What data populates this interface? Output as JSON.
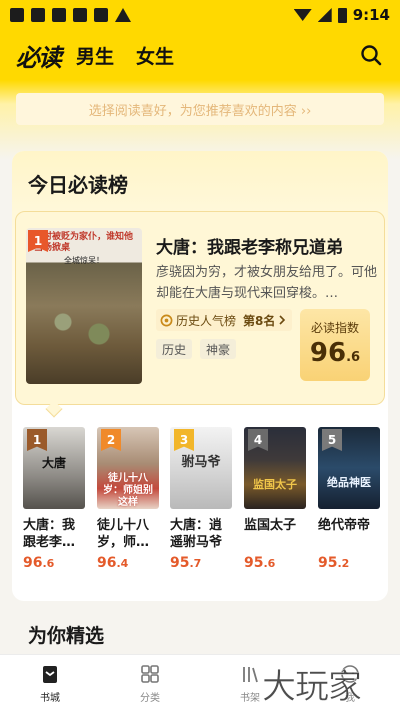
{
  "status_bar": {
    "time": "9:14"
  },
  "header": {
    "logo": "必读",
    "tabs": [
      {
        "label": "男生"
      },
      {
        "label": "女生"
      }
    ]
  },
  "preference_bar": {
    "text": "选择阅读喜好，为您推荐喜欢的内容 ››"
  },
  "daily": {
    "title": "今日必读榜",
    "featured": {
      "rank": "1",
      "title": "大唐：我跟老李称兄道弟",
      "description": "彦骁因为穷，才被女朋友给甩了。可他却能在大唐与现代来回穿梭。…",
      "rank_tag_label": "历史人气榜",
      "rank_tag_position": "第8名",
      "tags": [
        "历史",
        "神豪"
      ],
      "score_label": "必读指数",
      "score_int": "96",
      "score_dec": ".6",
      "cover_text_1": "一时被贬为家仆，谁知他当场掀桌",
      "cover_text_2": "全城惊呆！"
    },
    "books": [
      {
        "rank": "1",
        "name": "大唐：我跟老李…",
        "score_int": "96",
        "score_dec": ".6",
        "cover_text": "大唐"
      },
      {
        "rank": "2",
        "name": "徒儿十八岁，师…",
        "score_int": "96",
        "score_dec": ".4",
        "cover_text": "徒儿十八岁：师姐别这样"
      },
      {
        "rank": "3",
        "name": "大唐：逍遥驸马爷",
        "score_int": "95",
        "score_dec": ".7",
        "cover_text": "驸马爷"
      },
      {
        "rank": "4",
        "name": "监国太子",
        "score_int": "95",
        "score_dec": ".6",
        "cover_text": "监国太子"
      },
      {
        "rank": "5",
        "name": "绝代帝帝",
        "score_int": "95",
        "score_dec": ".2",
        "cover_text": "绝品神医"
      }
    ]
  },
  "section2": {
    "title": "为你精选"
  },
  "bottom_nav": [
    {
      "label": "书城",
      "icon": "book-city-icon",
      "active": true
    },
    {
      "label": "分类",
      "icon": "category-icon",
      "active": false
    },
    {
      "label": "书架",
      "icon": "bookshelf-icon",
      "active": false
    },
    {
      "label": "我",
      "icon": "profile-icon",
      "active": false
    }
  ],
  "watermark": {
    "text": "大玩家"
  },
  "colors": {
    "brand_yellow": "#ffd900",
    "score_orange": "#e45a2a"
  }
}
